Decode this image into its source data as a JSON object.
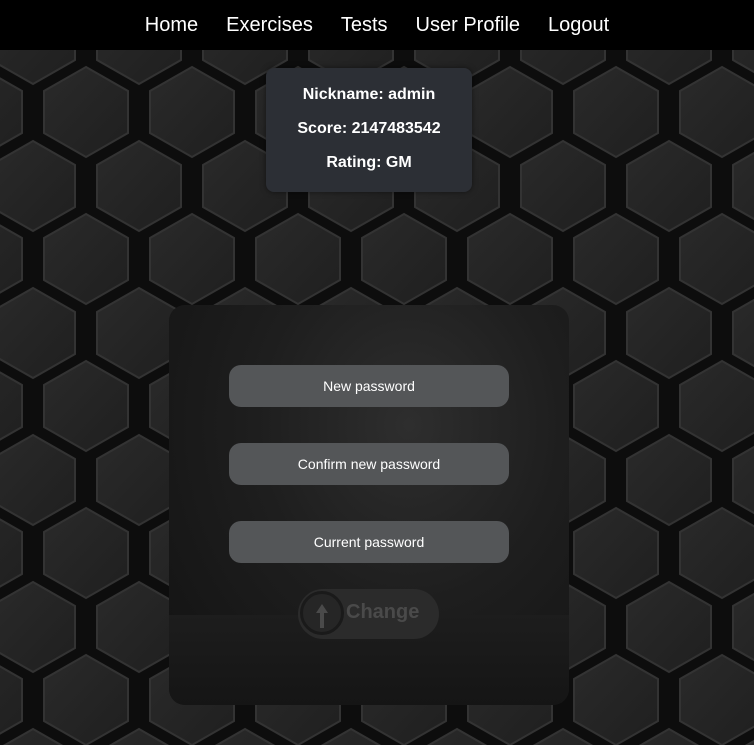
{
  "nav": {
    "items": [
      {
        "label": "Home"
      },
      {
        "label": "Exercises"
      },
      {
        "label": "Tests"
      },
      {
        "label": "User Profile"
      },
      {
        "label": "Logout"
      }
    ]
  },
  "profile": {
    "nickname_text": "Nickname: admin",
    "score_text": "Score: 2147483542",
    "rating_text": "Rating: GM"
  },
  "form": {
    "new_password_placeholder": "New password",
    "confirm_password_placeholder": "Confirm new password",
    "current_password_placeholder": "Current password",
    "change_label": "Change"
  },
  "icons": {
    "change_button_icon": "upload-arrow-icon"
  },
  "colors": {
    "nav_background": "#000000",
    "card_background": "#2c2f35",
    "input_background": "#545658",
    "text": "#ffffff"
  }
}
